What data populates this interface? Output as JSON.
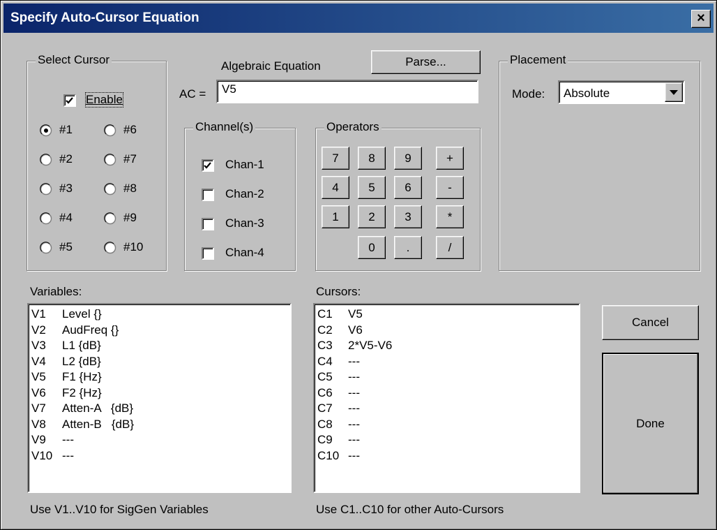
{
  "window": {
    "title": "Specify Auto-Cursor Equation",
    "close_glyph": "×"
  },
  "select_cursor": {
    "legend": "Select Cursor",
    "enable_label": "Enable",
    "enable_checked": true,
    "radios": [
      "#1",
      "#6",
      "#2",
      "#7",
      "#3",
      "#8",
      "#4",
      "#9",
      "#5",
      "#10"
    ],
    "selected": "#1"
  },
  "equation": {
    "label": "Algebraic Equation",
    "parse_label": "Parse...",
    "prefix": "AC =",
    "value": "V5"
  },
  "channels": {
    "legend": "Channel(s)",
    "items": [
      {
        "label": "Chan-1",
        "checked": true
      },
      {
        "label": "Chan-2",
        "checked": false
      },
      {
        "label": "Chan-3",
        "checked": false
      },
      {
        "label": "Chan-4",
        "checked": false
      }
    ]
  },
  "operators": {
    "legend": "Operators",
    "keys": [
      "7",
      "8",
      "9",
      "+",
      "4",
      "5",
      "6",
      "-",
      "1",
      "2",
      "3",
      "*",
      "0",
      ".",
      "/"
    ]
  },
  "placement": {
    "legend": "Placement",
    "mode_label": "Mode:",
    "mode_value": "Absolute"
  },
  "variables": {
    "label": "Variables:",
    "items": [
      {
        "id": "V1",
        "desc": "Level {}"
      },
      {
        "id": "V2",
        "desc": "AudFreq {}"
      },
      {
        "id": "V3",
        "desc": "L1 {dB}"
      },
      {
        "id": "V4",
        "desc": "L2 {dB}"
      },
      {
        "id": "V5",
        "desc": "F1 {Hz}"
      },
      {
        "id": "V6",
        "desc": "F2 {Hz}"
      },
      {
        "id": "V7",
        "desc": "Atten-A   {dB}"
      },
      {
        "id": "V8",
        "desc": "Atten-B   {dB}"
      },
      {
        "id": "V9",
        "desc": "---"
      },
      {
        "id": "V10",
        "desc": "---"
      }
    ],
    "hint": "Use V1..V10  for SigGen Variables"
  },
  "cursors": {
    "label": "Cursors:",
    "items": [
      {
        "id": "C1",
        "desc": "V5"
      },
      {
        "id": "C2",
        "desc": "V6"
      },
      {
        "id": "C3",
        "desc": "2*V5-V6"
      },
      {
        "id": "C4",
        "desc": "---"
      },
      {
        "id": "C5",
        "desc": "---"
      },
      {
        "id": "C6",
        "desc": "---"
      },
      {
        "id": "C7",
        "desc": "---"
      },
      {
        "id": "C8",
        "desc": "---"
      },
      {
        "id": "C9",
        "desc": "---"
      },
      {
        "id": "C10",
        "desc": "---"
      }
    ],
    "hint": "Use  C1..C10  for other Auto-Cursors"
  },
  "actions": {
    "cancel_label": "Cancel",
    "done_label": "Done"
  },
  "icons": {
    "close": "close-icon",
    "dropdown": "dropdown-arrow-icon",
    "check": "checkmark-icon",
    "radio_dot": "radio-dot-icon"
  }
}
